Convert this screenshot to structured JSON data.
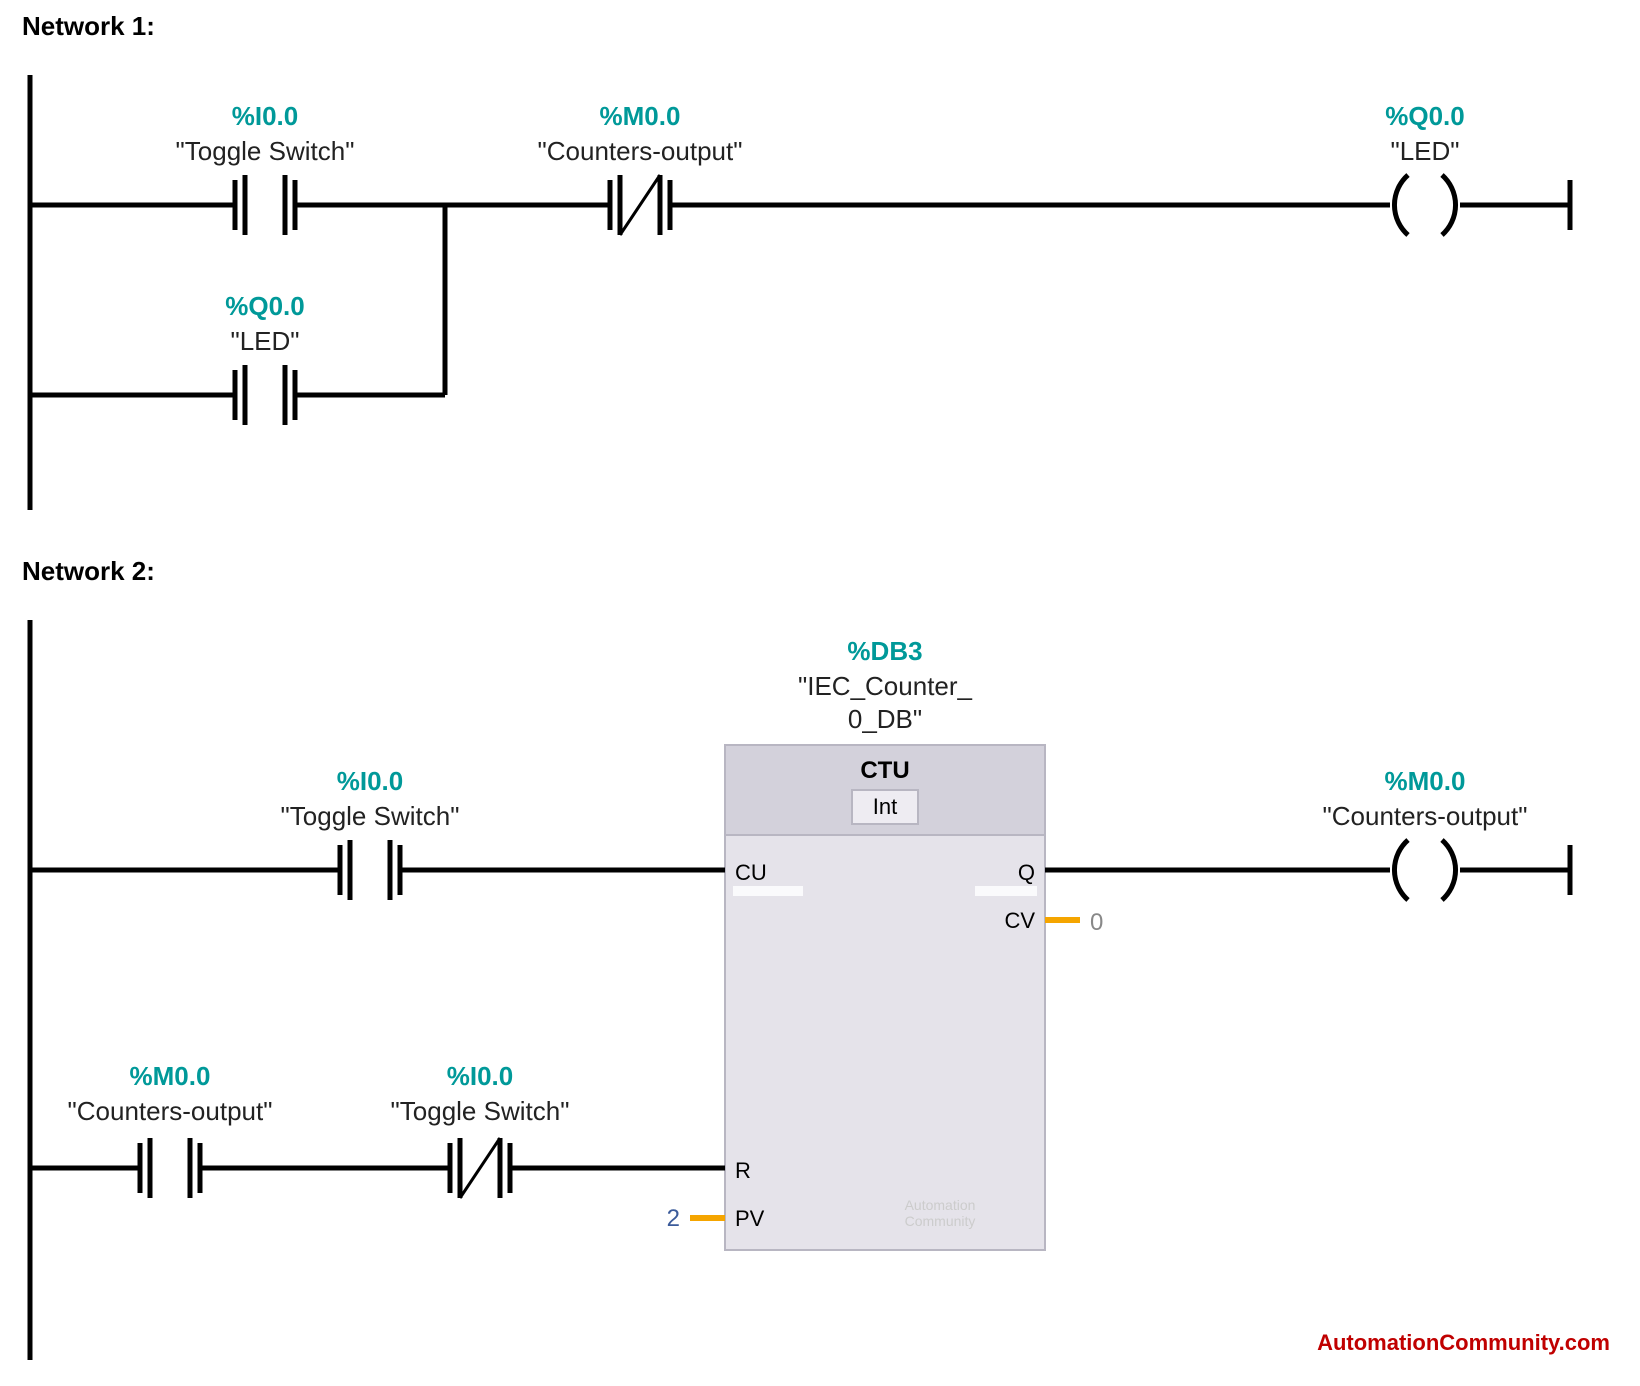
{
  "network1": {
    "title": "Network 1:",
    "contact_no_1": {
      "address": "%I0.0",
      "symbol": "\"Toggle Switch\""
    },
    "contact_nc": {
      "address": "%M0.0",
      "symbol": "\"Counters-output\""
    },
    "coil": {
      "address": "%Q0.0",
      "symbol": "\"LED\""
    },
    "contact_no_2": {
      "address": "%Q0.0",
      "symbol": "\"LED\""
    }
  },
  "network2": {
    "title": "Network 2:",
    "contact_cu": {
      "address": "%I0.0",
      "symbol": "\"Toggle Switch\""
    },
    "contact_r1": {
      "address": "%M0.0",
      "symbol": "\"Counters-output\""
    },
    "contact_r2": {
      "address": "%I0.0",
      "symbol": "\"Toggle Switch\""
    },
    "block": {
      "db_address": "%DB3",
      "db_symbol1": "\"IEC_Counter_",
      "db_symbol2": "0_DB\"",
      "name": "CTU",
      "type": "Int",
      "ports": {
        "cu": "CU",
        "r": "R",
        "pv": "PV",
        "q": "Q",
        "cv": "CV"
      },
      "pv_value": "2",
      "cv_value": "0",
      "watermark1": "Automation",
      "watermark2": "Community"
    },
    "coil": {
      "address": "%M0.0",
      "symbol": "\"Counters-output\""
    }
  },
  "credit": "AutomationCommunity.com"
}
